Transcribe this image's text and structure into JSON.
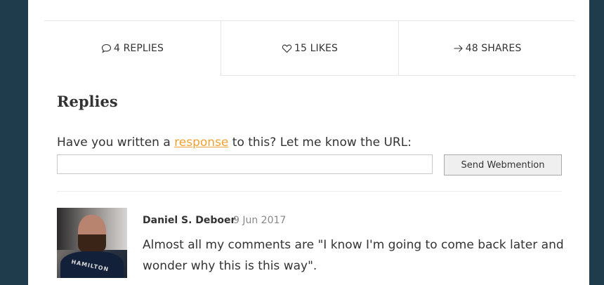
{
  "stats": {
    "replies": "4 REPLIES",
    "likes": "15 LIKES",
    "shares": "48 SHARES"
  },
  "replies_section": {
    "title": "Replies",
    "prompt_before": "Have you written a ",
    "prompt_link": "response",
    "prompt_after": " to this? Let me know the URL:",
    "url_value": "",
    "send_label": "Send Webmention"
  },
  "comments": [
    {
      "author": "Daniel S. Deboer",
      "date": "9 Jun 2017",
      "text": "Almost all my comments are \"I know I'm going to come back later and wonder why this is this way\".",
      "avatar_shirt_text": "HAMILTON"
    }
  ],
  "colors": {
    "background": "#1f3c4c",
    "link": "#f0a030",
    "page": "#ffffff"
  },
  "icons": {
    "replies": "speech-bubble-icon",
    "likes": "heart-icon",
    "shares": "arrow-right-icon"
  }
}
